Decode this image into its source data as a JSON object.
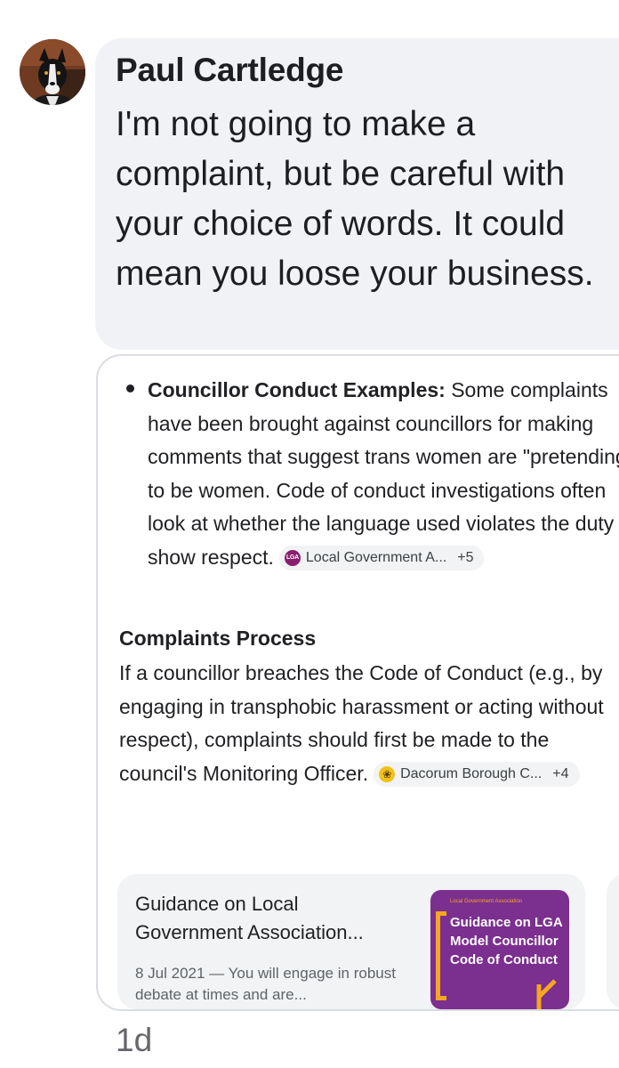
{
  "comment": {
    "author": "Paul Cartledge",
    "text": "I'm not going to make a complaint, but be careful with your choice of words. It could mean you loose your business.",
    "timestamp": "1d"
  },
  "attachment": {
    "bullet": {
      "label": "Councillor Conduct Examples:",
      "text": " Some complaints have been brought against councillors for making comments that suggest trans women are \"pretending\" to be women. Code of conduct investigations often look at whether the language used violates the duty to show respect.",
      "source_chip": {
        "icon_text": "LGA",
        "label": "Local Government A...",
        "more": "+5"
      }
    },
    "section": {
      "title": "Complaints Process",
      "text": "If a councillor breaches the Code of Conduct (e.g., by engaging in transphobic harassment or acting without respect), complaints should first be made to the council's Monitoring Officer.",
      "source_chip": {
        "icon_text": "❀",
        "label": "Dacorum Borough C...",
        "more": "+4"
      }
    },
    "result_card": {
      "title": "Guidance on Local Government Association...",
      "snippet": "8 Jul 2021 — You will engage in robust debate at times and are...",
      "thumbnail": {
        "org": "Local Government Association",
        "text": "Guidance on LGA Model Councillor Code of Conduct",
        "bg_color": "#7b2f8f",
        "accent_color": "#f5a623"
      }
    }
  }
}
